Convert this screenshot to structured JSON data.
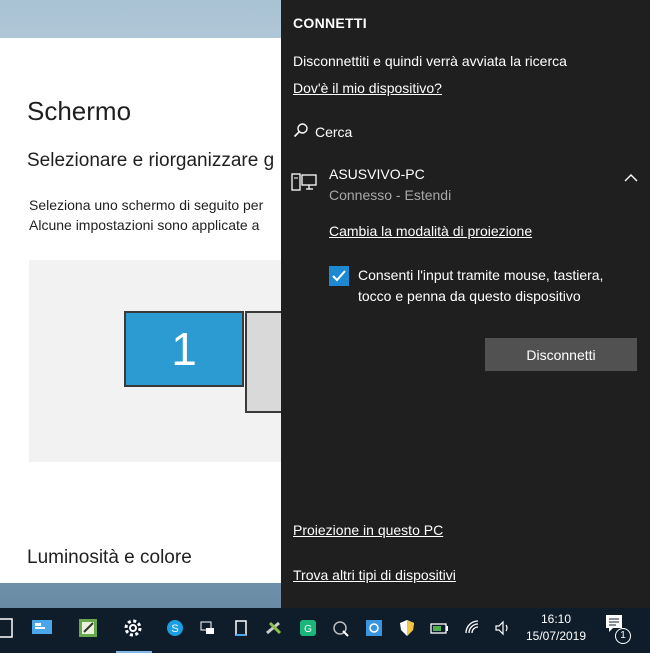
{
  "settings": {
    "title": "Schermo",
    "subtitle": "Selezionare e riorganizzare g",
    "desc_line1": "Seleziona uno schermo di seguito per",
    "desc_line2": "Alcune impostazioni sono applicate a",
    "monitor1_label": "1",
    "section_label": "Luminosità e colore"
  },
  "connect": {
    "title": "CONNETTI",
    "status": "Disconnettiti e quindi verrà avviata la ricerca",
    "where_link": "Dov'è il mio dispositivo?",
    "search_label": "Cerca",
    "device": {
      "name": "ASUSVIVO-PC",
      "status": "Connesso - Estendi"
    },
    "change_mode_link": "Cambia la modalità di proiezione",
    "allow_input_label": "Consenti l'input tramite mouse, tastiera, tocco e penna da questo dispositivo",
    "allow_input_checked": true,
    "disconnect_button": "Disconnetti",
    "project_link": "Proiezione in questo PC",
    "more_devices_link": "Trova altri tipi di dispositivi"
  },
  "taskbar": {
    "time": "16:10",
    "date": "15/07/2019",
    "notification_count": "1",
    "accent": "#1e88d0"
  }
}
